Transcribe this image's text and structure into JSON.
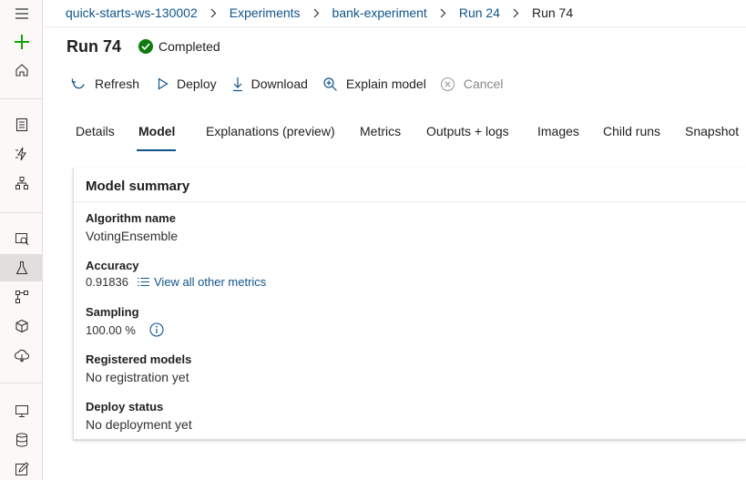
{
  "breadcrumb": {
    "items": [
      "quick-starts-ws-130002",
      "Experiments",
      "bank-experiment",
      "Run 24"
    ],
    "current": "Run 74"
  },
  "run": {
    "title": "Run 74",
    "status": "Completed"
  },
  "toolbar": {
    "refresh_label": "Refresh",
    "deploy_label": "Deploy",
    "download_label": "Download",
    "explain_label": "Explain model",
    "cancel_label": "Cancel"
  },
  "tabs": [
    "Details",
    "Model",
    "Explanations (preview)",
    "Metrics",
    "Outputs + logs",
    "Images",
    "Child runs",
    "Snapshot"
  ],
  "active_tab": "Model",
  "model_summary": {
    "title": "Model summary",
    "algorithm_label": "Algorithm name",
    "algorithm_value": "VotingEnsemble",
    "accuracy_label": "Accuracy",
    "accuracy_value": "0.91836",
    "metrics_link": "View all other metrics",
    "sampling_label": "Sampling",
    "sampling_value": "100.00 %",
    "registered_label": "Registered models",
    "registered_value": "No registration yet",
    "deploy_label": "Deploy status",
    "deploy_value": "No deployment yet"
  },
  "icons": {
    "rail": [
      "hamburger-icon",
      "plus-icon",
      "home-icon",
      "notebook-icon",
      "automl-icon",
      "designer-icon",
      "datasets-icon",
      "experiments-icon",
      "pipelines-icon",
      "models-icon",
      "endpoints-icon",
      "compute-icon",
      "datastores-icon",
      "labeling-icon"
    ]
  },
  "colors": {
    "accent": "#0f548c",
    "success": "#107c10",
    "new_green": "#13a10e"
  }
}
